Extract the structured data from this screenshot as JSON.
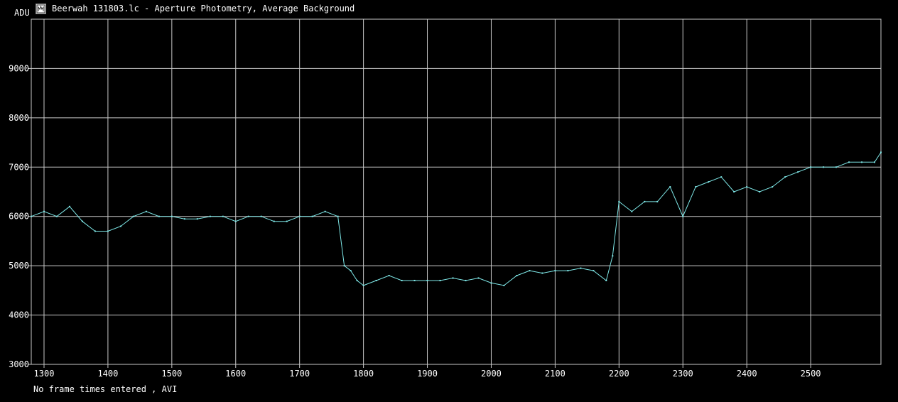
{
  "window": {
    "title": "Beerwah 131803.lc - Aperture Photometry, Average Background",
    "icon": "lightcurve-app-icon"
  },
  "footer": {
    "status": "No frame times entered , AVI"
  },
  "colors": {
    "background": "#000000",
    "grid": "#c8c8c8",
    "series": "#7fe8e8",
    "text": "#ffffff"
  },
  "chart_data": {
    "type": "line",
    "ylabel": "ADU",
    "xlabel": "",
    "xlim": [
      1280,
      2610
    ],
    "ylim": [
      3000,
      10000
    ],
    "x_ticks": [
      1300,
      1400,
      1500,
      1600,
      1700,
      1800,
      1900,
      2000,
      2100,
      2200,
      2300,
      2400,
      2500
    ],
    "y_ticks": [
      3000,
      4000,
      5000,
      6000,
      7000,
      8000,
      9000
    ],
    "grid": true,
    "series": [
      {
        "x": [
          1280,
          1300,
          1320,
          1340,
          1360,
          1380,
          1400,
          1420,
          1440,
          1460,
          1480,
          1500,
          1520,
          1540,
          1560,
          1580,
          1600,
          1620,
          1640,
          1660,
          1680,
          1700,
          1720,
          1740,
          1760,
          1770,
          1780,
          1790,
          1800,
          1820,
          1840,
          1860,
          1880,
          1900,
          1920,
          1940,
          1960,
          1980,
          2000,
          2020,
          2040,
          2060,
          2080,
          2100,
          2120,
          2140,
          2160,
          2180,
          2190,
          2200,
          2220,
          2240,
          2260,
          2280,
          2300,
          2320,
          2340,
          2360,
          2380,
          2400,
          2420,
          2440,
          2460,
          2480,
          2500,
          2520,
          2540,
          2560,
          2580,
          2600,
          2610
        ],
        "values": [
          6000,
          6100,
          6000,
          6200,
          5900,
          5700,
          5700,
          5800,
          6000,
          6100,
          6000,
          6000,
          5950,
          5950,
          6000,
          6000,
          5900,
          6000,
          6000,
          5900,
          5900,
          6000,
          6000,
          6100,
          6000,
          5000,
          4900,
          4700,
          4600,
          4700,
          4800,
          4700,
          4700,
          4700,
          4700,
          4750,
          4700,
          4750,
          4650,
          4600,
          4800,
          4900,
          4850,
          4900,
          4900,
          4950,
          4900,
          4700,
          5200,
          6300,
          6100,
          6300,
          6300,
          6600,
          6000,
          6600,
          6700,
          6800,
          6500,
          6600,
          6500,
          6600,
          6800,
          6900,
          7000,
          7000,
          7000,
          7100,
          7100,
          7100,
          7300
        ]
      }
    ]
  }
}
